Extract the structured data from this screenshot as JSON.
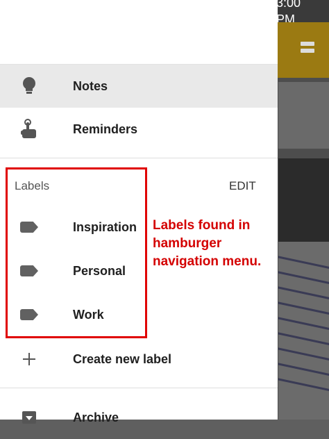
{
  "status_bar": {
    "time": "3:00 PM"
  },
  "drawer": {
    "items": [
      {
        "label": "Notes",
        "icon": "lightbulb-icon"
      },
      {
        "label": "Reminders",
        "icon": "reminder-finger-icon"
      }
    ],
    "labels_section": {
      "title": "Labels",
      "edit": "EDIT",
      "labels": [
        "Inspiration",
        "Personal",
        "Work"
      ]
    },
    "create_label": "Create new label",
    "archive": "Archive"
  },
  "annotation": {
    "lines": [
      "Labels found in",
      "hamburger",
      "navigation menu."
    ],
    "color": "#d40000"
  }
}
